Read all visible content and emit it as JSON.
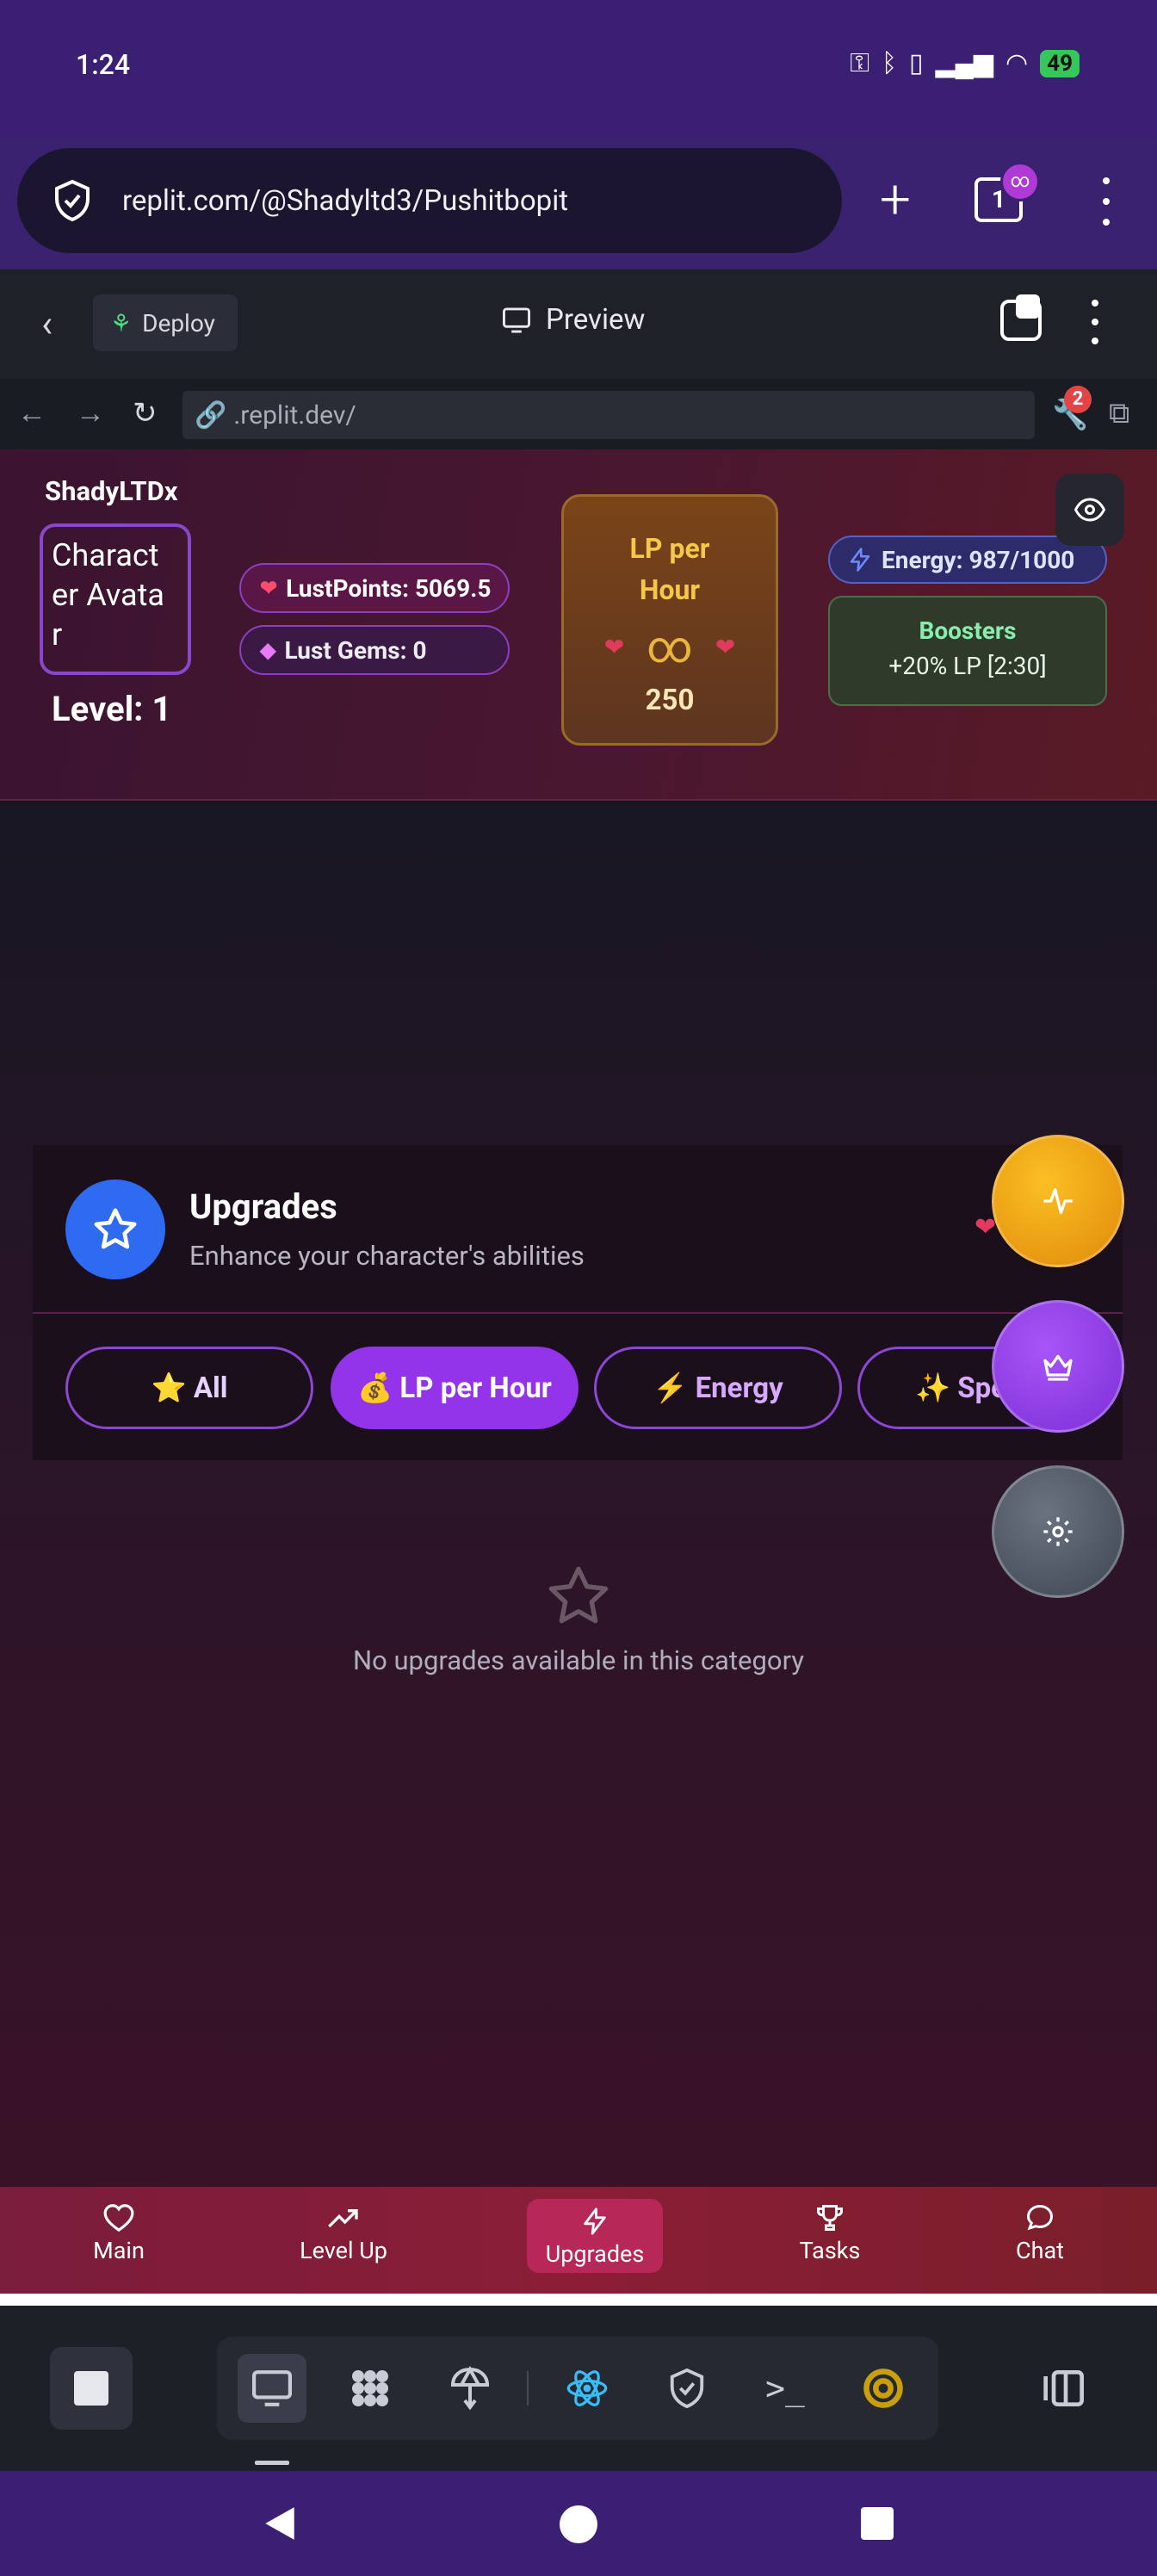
{
  "status_bar": {
    "time": "1:24",
    "battery": "49"
  },
  "browser": {
    "url": "replit.com/@Shadyltd3/Pushitbopit",
    "tab_count": "1"
  },
  "replit": {
    "deploy_label": "Deploy",
    "preview_label": "Preview",
    "address": ".replit.dev/",
    "devtools_count": "2"
  },
  "game": {
    "player_name": "ShadyLTDx",
    "avatar_placeholder": "Character Avatar",
    "level": "Level: 1",
    "lust_points": "LustPoints: 5069.5",
    "lust_gems": "Lust Gems: 0",
    "lp_per_hour": {
      "title": "LP per Hour",
      "symbol": "∞",
      "value": "250"
    },
    "energy": "Energy: 987/1000",
    "boosters": {
      "title": "Boosters",
      "value": "+20% LP [2:30]"
    }
  },
  "upgrades": {
    "title": "Upgrades",
    "subtitle": "Enhance your character's abilities",
    "tabs": [
      {
        "label": "⭐ All"
      },
      {
        "label": "💰 LP per Hour"
      },
      {
        "label": "⚡ Energy"
      },
      {
        "label": "✨ Special"
      }
    ],
    "empty_message": "No upgrades available in this category"
  },
  "bottom_nav": [
    {
      "label": "Main",
      "icon": "heart-icon"
    },
    {
      "label": "Level Up",
      "icon": "trending-up-icon"
    },
    {
      "label": "Upgrades",
      "icon": "zap-icon"
    },
    {
      "label": "Tasks",
      "icon": "trophy-icon"
    },
    {
      "label": "Chat",
      "icon": "chat-icon"
    }
  ],
  "colors": {
    "accent_purple": "#9333ea",
    "upgrades_blue": "#2f6bf0",
    "lp_gold": "#f5c84a",
    "boosters_green": "#86efac",
    "nav_active": "#b72758"
  }
}
